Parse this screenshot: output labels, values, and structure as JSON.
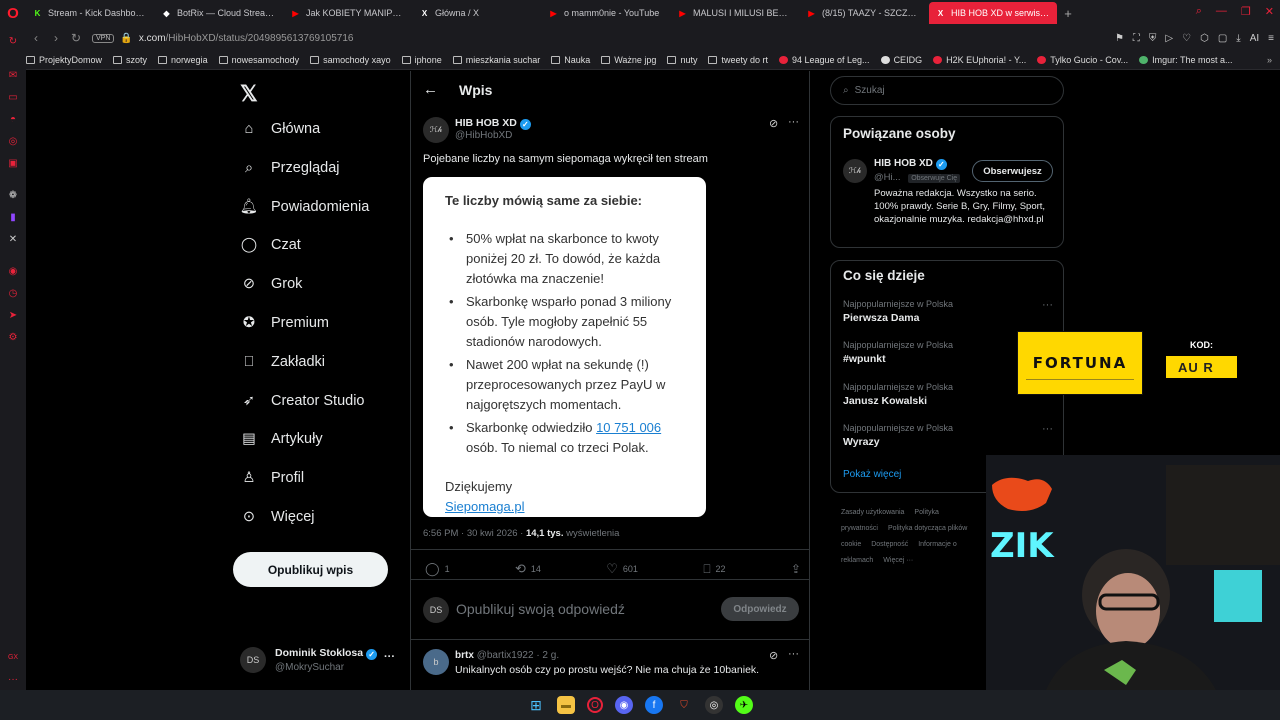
{
  "browser": {
    "tabs": [
      {
        "label": "Stream - Kick Dashboard",
        "color": "#53fc18",
        "glyph": "K",
        "active": false
      },
      {
        "label": "BotRix — Cloud Streaming",
        "color": "#ffffff",
        "glyph": "◆",
        "active": false
      },
      {
        "label": "Jak KOBIETY MANIPULU...",
        "color": "#ff0000",
        "glyph": "▶",
        "active": false
      },
      {
        "label": "Główna / X",
        "color": "#ffffff",
        "glyph": "X",
        "active": false
      },
      {
        "label": "o mamm0nie - YouTube",
        "color": "#ff0000",
        "glyph": "▶",
        "active": false
      },
      {
        "label": "MALUSI I MILUSI BEZNOG...",
        "color": "#ff0000",
        "glyph": "▶",
        "active": false
      },
      {
        "label": "(8/15) TAAZY - SZCZECIN...",
        "color": "#ff0000",
        "glyph": "▶",
        "active": false
      },
      {
        "label": "HIB HOB XD w serwisie X:...",
        "color": "#ffffff",
        "glyph": "X",
        "active": true
      }
    ],
    "url_host": "x.com",
    "url_path": "/HibHobXD/status/2049895613769105716",
    "vpn_label": "VPN",
    "ai_label": "AI",
    "bookmarks": [
      "ProjektyDomow",
      "szoty",
      "norwegia",
      "nowesamochody",
      "samochody xayo",
      "iphone",
      "mieszkania suchar",
      "Nauka",
      "Ważne jpg",
      "nuty",
      "tweety do rt",
      "94 League of Leg...",
      "CEIDG",
      "H2K EUphoria! - Y...",
      "Tylko Gucio - Cov...",
      "Imgur: The most a..."
    ]
  },
  "nav": {
    "items": [
      {
        "label": "Główna",
        "icon": "home-icon"
      },
      {
        "label": "Przeglądaj",
        "icon": "search-icon"
      },
      {
        "label": "Powiadomienia",
        "icon": "bell-icon"
      },
      {
        "label": "Czat",
        "icon": "chat-icon"
      },
      {
        "label": "Grok",
        "icon": "grok-icon"
      },
      {
        "label": "Premium",
        "icon": "premium-icon"
      },
      {
        "label": "Zakładki",
        "icon": "bookmark-icon"
      },
      {
        "label": "Creator Studio",
        "icon": "rocket-icon"
      },
      {
        "label": "Artykuły",
        "icon": "article-icon"
      },
      {
        "label": "Profil",
        "icon": "profile-icon"
      },
      {
        "label": "Więcej",
        "icon": "more-icon"
      }
    ],
    "post_button": "Opublikuj wpis",
    "account": {
      "name": "Dominik Stoklosa",
      "handle": "@MokrySuchar"
    }
  },
  "post": {
    "header_title": "Wpis",
    "author_name": "HIB HOB XD",
    "author_handle": "@HibHobXD",
    "text": "Pojebane liczby na samym siepomaga wykręcił ten stream",
    "image": {
      "heading": "Te liczby mówią same za siebie:",
      "bullets": [
        "50% wpłat na skarbonce to kwoty poniżej 20 zł. To dowód, że każda złotówka ma znaczenie!",
        "Skarbonkę wsparło ponad 3 miliony osób. Tyle mogłoby zapełnić 55 stadionów narodowych.",
        "Nawet 200 wpłat na sekundę (!) przeprocesowanych przez PayU w najgorętszych momentach."
      ],
      "last_bullet_before": "Skarbonkę odwiedziło ",
      "last_bullet_link": "10 751 006",
      "last_bullet_after": " osób. To niemal co trzeci Polak.",
      "thanks": "Dziękujemy",
      "thanks_link": "Siepomaga.pl"
    },
    "meta_time": "6:56 PM · 30 kwi 2026 · ",
    "meta_views": "14,1 tys.",
    "meta_views_label": " wyświetlenia",
    "counts": {
      "replies": "1",
      "reposts": "14",
      "likes": "601",
      "bookmarks": "22"
    },
    "reply_placeholder": "Opublikuj swoją odpowiedź",
    "reply_button": "Odpowiedz"
  },
  "reply": {
    "name": "brtx",
    "handle": "@bartix1922 · 2 g.",
    "text": "Unikalnych osób czy po prostu wejść? Nie ma chuja że 10baniek."
  },
  "right": {
    "search_placeholder": "Szukaj",
    "related_title": "Powiązane osoby",
    "related": {
      "name": "HIB HOB XD",
      "handle": "@Hi...",
      "follows_you": "Obserwuje Cię",
      "follow_button": "Obserwujesz",
      "bio": "Poważna redakcja. Wszystko na serio. 100% prawdy. Serie B, Gry, Filmy, Sport, okazjonalnie muzyka. redakcja@hhxd.pl"
    },
    "trends_title": "Co się dzieje",
    "trends": [
      {
        "context": "Najpopularniejsze w Polska",
        "name": "Pierwsza Dama"
      },
      {
        "context": "Najpopularniejsze w Polska",
        "name": "#wpunkt"
      },
      {
        "context": "Najpopularniejsze w Polska",
        "name": "Janusz Kowalski"
      },
      {
        "context": "Najpopularniejsze w Polska",
        "name": "Wyrazy"
      }
    ],
    "show_more": "Pokaż więcej",
    "footer": [
      "Zasady użytkowania",
      "Polityka prywatności",
      "Polityka dotycząca plików cookie",
      "Dostępność",
      "Informacje o reklamach",
      "Więcej ···"
    ]
  },
  "overlay": {
    "sponsor": "FORTUNA",
    "code_label": "KOD:",
    "code_value": "AU R"
  },
  "colors": {
    "accent": "#1d9bf0",
    "opera_red": "#e8223a",
    "fortuna_yellow": "#ffd800"
  }
}
